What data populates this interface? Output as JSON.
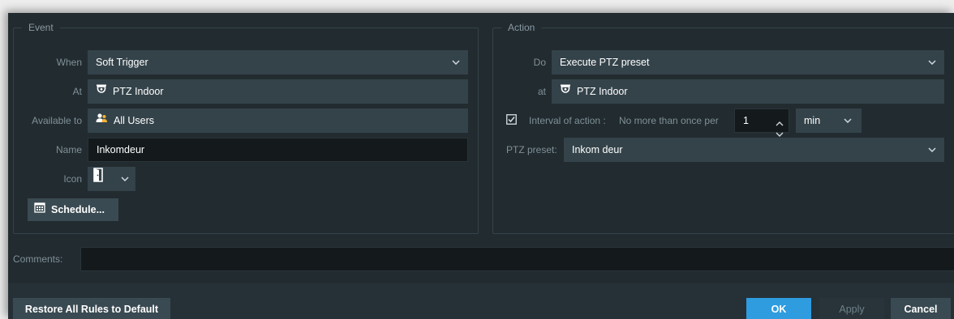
{
  "event": {
    "title": "Event",
    "when_label": "When",
    "when_value": "Soft Trigger",
    "at_label": "At",
    "at_value": "PTZ Indoor",
    "available_label": "Available to",
    "available_value": "All Users",
    "name_label": "Name",
    "name_value": "Inkomdeur",
    "icon_label": "Icon",
    "schedule_label": "Schedule..."
  },
  "action": {
    "title": "Action",
    "do_label": "Do",
    "do_value": "Execute PTZ preset",
    "at_label": "at",
    "at_value": "PTZ Indoor",
    "interval_label": "Interval of action :",
    "interval_text": "No more than once per",
    "interval_value": "1",
    "interval_unit": "min",
    "interval_checked": true,
    "preset_label": "PTZ preset:",
    "preset_value": "Inkom deur"
  },
  "comments": {
    "label": "Comments:",
    "value": ""
  },
  "footer": {
    "restore_label": "Restore All Rules to Default",
    "ok_label": "OK",
    "apply_label": "Apply",
    "cancel_label": "Cancel"
  },
  "colors": {
    "background": "#222b2f",
    "field": "#34434a",
    "accent": "#2f9ce0",
    "label": "#7f9199"
  }
}
